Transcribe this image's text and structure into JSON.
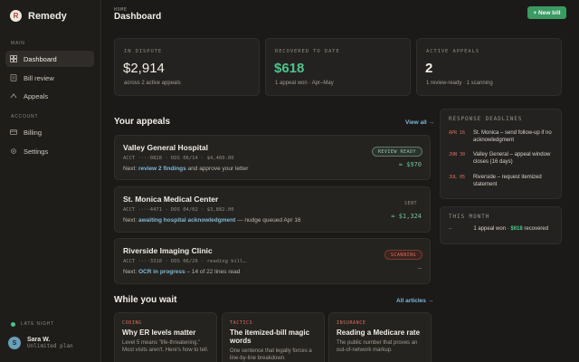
{
  "brand": {
    "logo": "R",
    "name": "Remedy"
  },
  "sidebar": {
    "main_label": "MAIN",
    "account_label": "ACCOUNT",
    "items": [
      {
        "label": "Dashboard",
        "icon": "grid-icon"
      },
      {
        "label": "Bill review",
        "icon": "document-icon"
      },
      {
        "label": "Appeals",
        "icon": "arrow-icon"
      },
      {
        "label": "Billing",
        "icon": "card-icon"
      },
      {
        "label": "Settings",
        "icon": "gear-icon"
      }
    ],
    "late_label": "LATE NIGHT",
    "user": {
      "initial": "S",
      "name": "Sara W.",
      "plan": "Unlimited plan"
    }
  },
  "header": {
    "breadcrumb": "HOME",
    "title": "Dashboard",
    "new_bill_label": "+ New bill"
  },
  "stats": [
    {
      "label": "IN DISPUTE",
      "value": "$2,914",
      "sub": "across 2 active appeals"
    },
    {
      "label": "RECOVERED TO DATE",
      "value": "$618",
      "sub": "1 appeal won · Apr–May"
    },
    {
      "label": "ACTIVE APPEALS",
      "value": "2",
      "sub": "1 review-ready · 1 scanning"
    }
  ],
  "appeals": {
    "title": "Your appeals",
    "view_all": "View all →",
    "items": [
      {
        "name": "Valley General Hospital",
        "acct": "ACCT ····0828 · DOS 06/14 · $4,460.00",
        "next_prefix": "Next: ",
        "next_link": "review 2 findings",
        "next_suffix": " and approve your letter",
        "badge": "REVIEW READY",
        "amount": "≈ $970"
      },
      {
        "name": "St. Monica Medical Center",
        "acct": "ACCT ····4471 · DOS 04/02 · $3,882.00",
        "next_prefix": "Next: ",
        "next_link": "awaiting hospital acknowledgment",
        "next_suffix": " — nudge queued Apr 16",
        "badge": "SENT",
        "amount": "≈ $1,324"
      },
      {
        "name": "Riverside Imaging Clinic",
        "acct": "ACCT ····3318 · DOS 06/26 · reading bill…",
        "next_prefix": "Next: ",
        "next_link": "OCR in progress",
        "next_suffix": " – 14 of 22 lines read",
        "badge": "SCANNING",
        "amount": "—"
      }
    ]
  },
  "deadlines": {
    "title": "RESPONSE DEADLINES",
    "items": [
      {
        "date": "APR 16",
        "text": "St. Monica – send follow-up if no acknowledgment"
      },
      {
        "date": "JUN 30",
        "text": "Valley General – appeal window closes (16 days)"
      },
      {
        "date": "JUL 05",
        "text": "Riverside – request itemized statement"
      }
    ]
  },
  "this_month": {
    "title": "THIS MONTH",
    "dash": "–",
    "prefix": "1 appeal won · ",
    "amount": "$618",
    "suffix": " recovered"
  },
  "articles": {
    "title": "While you wait",
    "all_link": "All articles →",
    "items": [
      {
        "tag": "CODING",
        "title": "Why ER levels matter",
        "body": "Level 5 means \"life-threatening.\" Most visits aren't. Here's how to tell."
      },
      {
        "tag": "TACTICS",
        "title": "The itemized-bill magic words",
        "body": "One sentence that legally forces a line-by-line breakdown."
      },
      {
        "tag": "INSURANCE",
        "title": "Reading a Medicare rate",
        "body": "The public number that proves an out-of-network markup."
      }
    ]
  },
  "colors": {
    "accent_green": "#4cc48a",
    "link_blue": "#78b8d8",
    "alert_red": "#e06e5a",
    "background": "#1c1a18"
  }
}
